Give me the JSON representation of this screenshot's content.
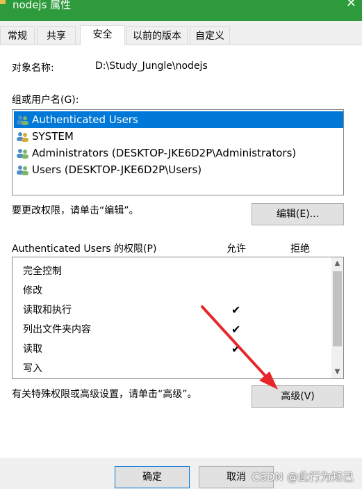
{
  "window": {
    "title": "nodejs 属性",
    "close_glyph": "✕"
  },
  "tabs": [
    {
      "label": "常规"
    },
    {
      "label": "共享"
    },
    {
      "label": "安全"
    },
    {
      "label": "以前的版本"
    },
    {
      "label": "自定义"
    }
  ],
  "active_tab": "安全",
  "object": {
    "label": "对象名称:",
    "value": "D:\\Study_Jungle\\nodejs"
  },
  "groups": {
    "label": "组或用户名(G):",
    "items": [
      {
        "label": "Authenticated Users",
        "selected": true
      },
      {
        "label": "SYSTEM",
        "selected": false
      },
      {
        "label": "Administrators (DESKTOP-JKE6D2P\\Administrators)",
        "selected": false
      },
      {
        "label": "Users (DESKTOP-JKE6D2P\\Users)",
        "selected": false
      }
    ]
  },
  "edit_hint": "要更改权限，请单击“编辑”。",
  "edit_button": "编辑(E)...",
  "permissions": {
    "header": "Authenticated Users 的权限(P)",
    "allow_header": "允许",
    "deny_header": "拒绝",
    "check_glyph": "✔",
    "rows": [
      {
        "label": "完全控制",
        "allow": false
      },
      {
        "label": "修改",
        "allow": false
      },
      {
        "label": "读取和执行",
        "allow": true
      },
      {
        "label": "列出文件夹内容",
        "allow": true
      },
      {
        "label": "读取",
        "allow": true
      },
      {
        "label": "写入",
        "allow": false
      }
    ]
  },
  "advanced_hint": "有关特殊权限或高级设置，请单击“高级”。",
  "advanced_button": "高级(V)",
  "footer": {
    "ok": "确定",
    "cancel": "取消"
  },
  "watermark": "CSDN @此行为知己",
  "colors": {
    "title_bar": "#2d9a3c",
    "selection": "#0078d7",
    "arrow": "#e8262a"
  }
}
